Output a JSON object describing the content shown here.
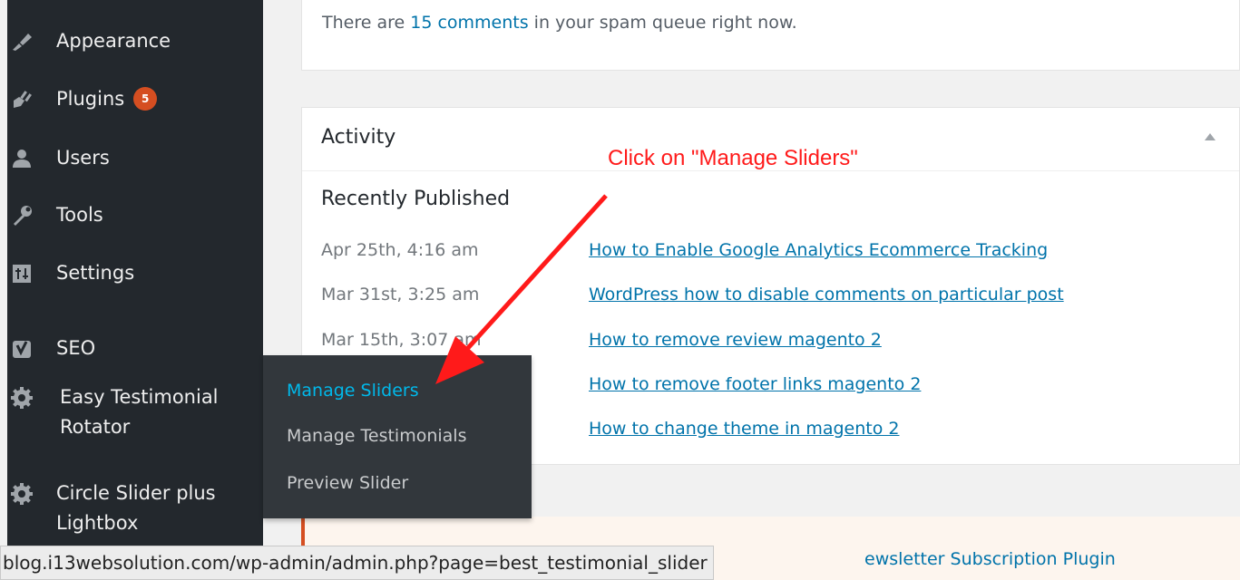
{
  "sidebar": {
    "items": [
      {
        "label": "Appearance",
        "icon": "paintbrush-icon"
      },
      {
        "label": "Plugins",
        "icon": "plugin-icon",
        "badge": "5"
      },
      {
        "label": "Users",
        "icon": "users-icon"
      },
      {
        "label": "Tools",
        "icon": "wrench-icon"
      },
      {
        "label": "Settings",
        "icon": "settings-icon"
      },
      {
        "label": "SEO",
        "icon": "yoast-icon"
      },
      {
        "label_line1": "Easy Testimonial",
        "label_line2": "Rotator",
        "icon": "gear-icon"
      },
      {
        "label_line1": "Circle Slider plus",
        "label_line2": "Lightbox",
        "icon": "gear-icon"
      }
    ]
  },
  "submenu": {
    "items": [
      "Manage Sliders",
      "Manage Testimonials",
      "Preview Slider"
    ],
    "active": "Manage Sliders"
  },
  "spam": {
    "prefix": "There are ",
    "link": "15 comments",
    "suffix": " in your spam queue right now."
  },
  "activity": {
    "title": "Activity",
    "section": "Recently Published",
    "posts": [
      {
        "date": "Apr 25th, 4:16 am",
        "title": "How to Enable Google Analytics Ecommerce Tracking"
      },
      {
        "date": "Mar 31st, 3:25 am",
        "title": "WordPress how to disable comments on particular post"
      },
      {
        "date": "Mar 15th, 3:07 am",
        "title": "How to remove review magento 2"
      },
      {
        "date": "",
        "title": "How to remove footer links magento 2"
      },
      {
        "date": "",
        "title": "How to change theme in magento 2"
      }
    ]
  },
  "notice": {
    "text": "ewsletter Subscription Plugin"
  },
  "status_bar": {
    "url": "blog.i13websolution.com/wp-admin/admin.php?page=best_testimonial_slider"
  },
  "annotation": {
    "text": "Click on \"Manage Sliders\""
  },
  "colors": {
    "sidebar_bg": "#23282d",
    "submenu_bg": "#32373c",
    "link": "#0073aa",
    "active": "#00b9eb",
    "badge": "#d54e21",
    "annotation": "#ff1a1a"
  }
}
